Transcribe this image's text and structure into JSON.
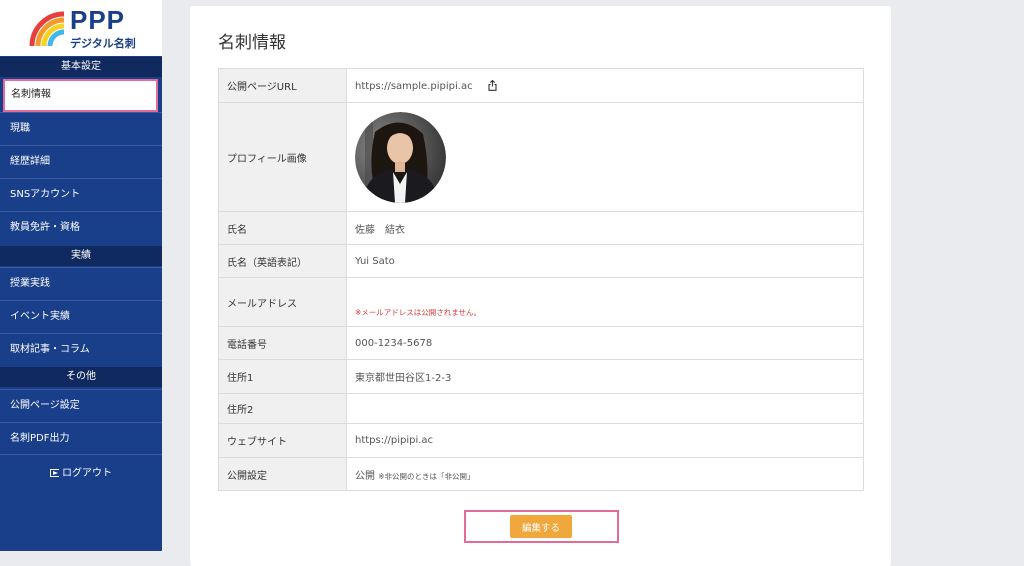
{
  "logo": {
    "brand": "PPP",
    "subtitle": "デジタル名刺"
  },
  "sidebar": {
    "sections": [
      {
        "heading": "基本設定",
        "items": [
          "名刺情報",
          "現職",
          "経歴詳細",
          "SNSアカウント",
          "教員免許・資格"
        ]
      },
      {
        "heading": "実績",
        "items": [
          "授業実践",
          "イベント実績",
          "取材記事・コラム"
        ]
      },
      {
        "heading": "その他",
        "items": [
          "公開ページ設定",
          "名刺PDF出力"
        ]
      }
    ],
    "active_item": "名刺情報",
    "logout_label": "ログアウト"
  },
  "page": {
    "title": "名刺情報"
  },
  "rows": {
    "url": {
      "label": "公開ページURL",
      "value": "https://sample.pipipi.ac"
    },
    "photo": {
      "label": "プロフィール画像"
    },
    "name": {
      "label": "氏名",
      "value": "佐藤　結衣"
    },
    "name_en": {
      "label": "氏名（英語表記）",
      "value": "Yui Sato"
    },
    "email": {
      "label": "メールアドレス",
      "value": "",
      "note": "※メールアドレスは公開されません。"
    },
    "phone": {
      "label": "電話番号",
      "value": "000-1234-5678"
    },
    "address1": {
      "label": "住所1",
      "value": "東京都世田谷区1-2-3"
    },
    "address2": {
      "label": "住所2",
      "value": ""
    },
    "website": {
      "label": "ウェブサイト",
      "value": "https://pipipi.ac"
    },
    "visibility": {
      "label": "公開設定",
      "value": "公開",
      "note": "※非公開のときは「非公開」"
    }
  },
  "edit_button": {
    "label": "編集する"
  },
  "colors": {
    "sidebar": "#1a3f8a",
    "section_heading": "#10295e",
    "highlight": "#e46a9a",
    "button": "#f0a83c",
    "note_red": "#d83a3a"
  }
}
